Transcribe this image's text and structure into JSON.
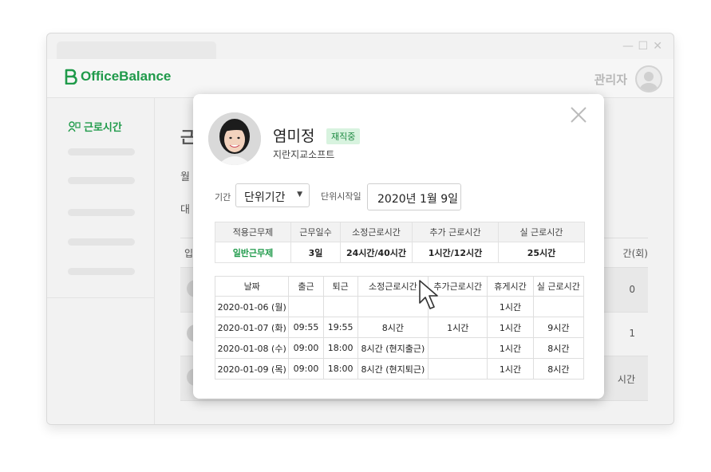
{
  "app": {
    "brand": "OfficeBalance",
    "admin_label": "관리자",
    "brand_color": "#1f9a4a"
  },
  "sidebar": {
    "active_item": {
      "label": "근로시간",
      "icon": "person-clock-icon"
    }
  },
  "background": {
    "title_fragment": "근",
    "line1_fragment": "월",
    "line2_fragment": "대",
    "col_fragment": "입",
    "col_right_fragment": "간(회)",
    "row_values": [
      "0",
      "1",
      "시간"
    ]
  },
  "modal": {
    "name": "염미정",
    "status_badge": "재직중",
    "company": "지란지교소프트",
    "period_label": "기간",
    "period_value": "단위기간",
    "unit_start_label": "단위시작일",
    "unit_start_value": "2020년 1월 9일",
    "summary": {
      "headers": [
        "적용근무제",
        "근무일수",
        "소정근로시간",
        "추가 근로시간",
        "실 근로시간"
      ],
      "values": [
        "일반근무제",
        "3일",
        "24시간/40시간",
        "1시간/12시간",
        "25시간"
      ]
    },
    "detail": {
      "headers": [
        "날짜",
        "출근",
        "퇴근",
        "소정근로시간",
        "추가근로시간",
        "휴게시간",
        "실 근로시간"
      ],
      "rows": [
        [
          "2020-01-06 (월)",
          "",
          "",
          "",
          "",
          "1시간",
          ""
        ],
        [
          "2020-01-07 (화)",
          "09:55",
          "19:55",
          "8시간",
          "1시간",
          "1시간",
          "9시간"
        ],
        [
          "2020-01-08 (수)",
          "09:00",
          "18:00",
          "8시간 (현지출근)",
          "",
          "1시간",
          "8시간"
        ],
        [
          "2020-01-09 (목)",
          "09:00",
          "18:00",
          "8시간 (현지퇴근)",
          "",
          "1시간",
          "8시간"
        ]
      ]
    }
  }
}
